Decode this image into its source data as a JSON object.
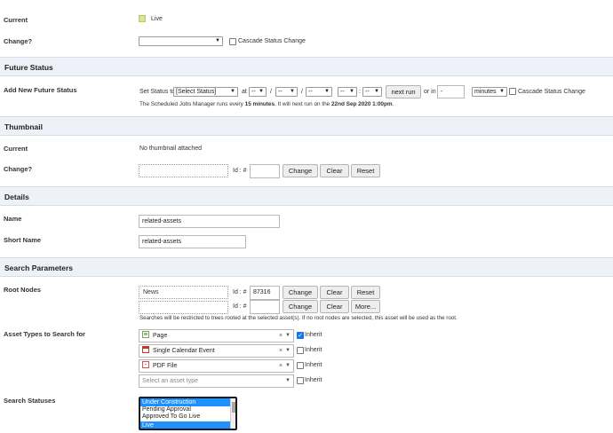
{
  "status": {
    "current_label": "Current",
    "current_value": "Live",
    "live_color": "#d4e88a",
    "change_label": "Change?",
    "change_select": "",
    "cascade_label": "Cascade Status Change"
  },
  "future_status": {
    "section_title": "Future Status",
    "add_label": "Add New Future Status",
    "set_status_to": "Set Status to",
    "status_select": "[Select Status]",
    "at": "at",
    "dash": "--",
    "slash": "/",
    "dot": ".",
    "colon": ":",
    "next_run": "next run",
    "or_in": "or in",
    "or_in_value": "-",
    "unit_select": "minutes",
    "cascade_label": "Cascade Status Change",
    "note_pre": "The Scheduled Jobs Manager runs every ",
    "note_bold": "15 minutes",
    "note_mid": ". It will next run on the ",
    "note_date": "22nd Sep 2020 1:00pm",
    "note_end": "."
  },
  "thumbnail": {
    "section_title": "Thumbnail",
    "current_label": "Current",
    "current_value": "No thumbnail attached",
    "change_label": "Change?",
    "id_label": "Id : #",
    "change_btn": "Change",
    "clear_btn": "Clear",
    "reset_btn": "Reset"
  },
  "details": {
    "section_title": "Details",
    "name_label": "Name",
    "name_value": "related-assets",
    "short_name_label": "Short Name",
    "short_name_value": "related-assets"
  },
  "search": {
    "section_title": "Search Parameters",
    "root_label": "Root Nodes",
    "root1_name": "News",
    "id_label": "Id : #",
    "root1_id": "87316",
    "change_btn": "Change",
    "clear_btn": "Clear",
    "reset_btn": "Reset",
    "more_btn": "More...",
    "root_note": "Searches will be restricted to trees rooted at the selected asset(s). If no root nodes are selected, this asset will be used as the root.",
    "types_label": "Asset Types to Search for",
    "types": [
      {
        "name": "Page",
        "icon": "page-icon",
        "inherit": true
      },
      {
        "name": "Single Calendar Event",
        "icon": "calendar-icon",
        "inherit": false
      },
      {
        "name": "PDF File",
        "icon": "pdf-icon",
        "inherit": false
      }
    ],
    "type_placeholder": "Select an asset type",
    "inherit_label": "Inherit",
    "clear_x": "×",
    "statuses_label": "Search Statuses",
    "statuses": [
      "Under Construction",
      "Pending Approval",
      "Approved To Go Live",
      "Live"
    ],
    "selected_color": "#1e90ff"
  }
}
